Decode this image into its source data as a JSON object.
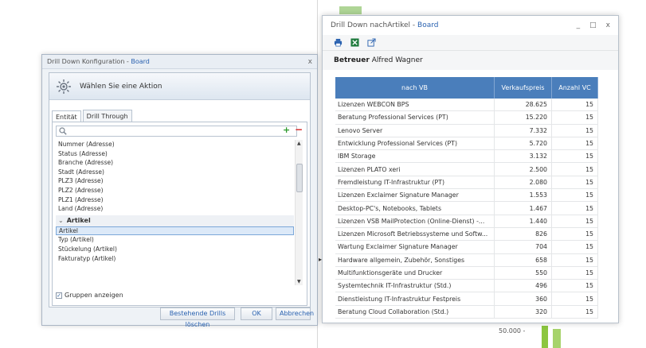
{
  "background": {
    "axis_label": "50.000 -"
  },
  "config_dialog": {
    "title_prefix": "Drill Down Konfiguration - ",
    "title_board": "Board",
    "close_glyph": "x",
    "header_text": "Wählen Sie eine Aktion",
    "tabs": [
      {
        "label": "Entität"
      },
      {
        "label": "Drill Through"
      }
    ],
    "search_placeholder": "",
    "add_glyph": "+",
    "remove_glyph": "−",
    "list_items_top": [
      "Nummer (Adresse)",
      "Status (Adresse)",
      "Branche (Adresse)",
      "Stadt (Adresse)",
      "PLZ3 (Adresse)",
      "PLZ2 (Adresse)",
      "PLZ1 (Adresse)",
      "Land (Adresse)"
    ],
    "group_label": "Artikel",
    "selected_item": "Artikel",
    "list_items_bottom": [
      "Typ (Artikel)",
      "Stückelung (Artikel)",
      "Fakturatyp (Artikel)"
    ],
    "group_checkbox_label": "Gruppen anzeigen",
    "group_checkbox_checked": true,
    "buttons": {
      "clear": "Bestehende Drills löschen",
      "ok": "OK",
      "cancel": "Abbrechen"
    }
  },
  "drill_window": {
    "title_prefix": "Drill Down nachArtikel - ",
    "title_board": "Board",
    "controls": {
      "minimize": "_",
      "maximize": "□",
      "close": "x"
    },
    "subtitle_bold": "Betreuer",
    "subtitle_name": "Alfred Wagner",
    "columns": [
      "nach VB",
      "Verkaufspreis",
      "Anzahl VC"
    ],
    "rows": [
      {
        "name": "Lizenzen WEBCON BPS",
        "price": "28.625",
        "count": "15"
      },
      {
        "name": "Beratung Professional Services (PT)",
        "price": "15.220",
        "count": "15"
      },
      {
        "name": "Lenovo Server",
        "price": "7.332",
        "count": "15"
      },
      {
        "name": "Entwicklung Professional Services (PT)",
        "price": "5.720",
        "count": "15"
      },
      {
        "name": "IBM Storage",
        "price": "3.132",
        "count": "15"
      },
      {
        "name": "Lizenzen PLATO xeri",
        "price": "2.500",
        "count": "15"
      },
      {
        "name": "Fremdleistung IT-Infrastruktur (PT)",
        "price": "2.080",
        "count": "15"
      },
      {
        "name": "Lizenzen Exclaimer Signature Manager",
        "price": "1.553",
        "count": "15"
      },
      {
        "name": "Desktop-PC's, Notebooks, Tablets",
        "price": "1.467",
        "count": "15"
      },
      {
        "name": "Lizenzen VSB MailProtection (Online-Dienst) -...",
        "price": "1.440",
        "count": "15"
      },
      {
        "name": "Lizenzen Microsoft Betriebssysteme und Softw...",
        "price": "826",
        "count": "15"
      },
      {
        "name": "Wartung Exclaimer Signature Manager",
        "price": "704",
        "count": "15"
      },
      {
        "name": "Hardware allgemein, Zubehör, Sonstiges",
        "price": "658",
        "count": "15"
      },
      {
        "name": "Multifunktionsgeräte und Drucker",
        "price": "550",
        "count": "15"
      },
      {
        "name": "Systemtechnik IT-Infrastruktur (Std.)",
        "price": "496",
        "count": "15"
      },
      {
        "name": "Dienstleistung IT-Infrastruktur Festpreis",
        "price": "360",
        "count": "15"
      },
      {
        "name": "Beratung Cloud Collaboration (Std.)",
        "price": "320",
        "count": "15"
      }
    ]
  },
  "colors": {
    "header_blue": "#4a7ebb",
    "link_blue": "#2a62b0",
    "excel_green": "#1e7a3c",
    "add_green": "#2c9a2c",
    "remove_red": "#d42222"
  },
  "icons": {
    "print": "printer-icon",
    "excel": "excel-icon",
    "export": "export-icon",
    "settings": "gear-icon",
    "search": "search-icon"
  }
}
